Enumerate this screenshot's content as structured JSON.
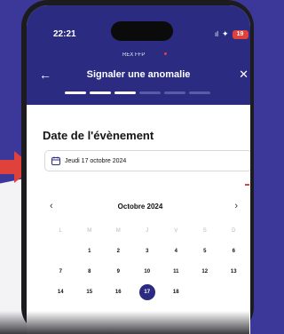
{
  "status_bar": {
    "time": "22:21",
    "signal": "ıl",
    "battery": "19"
  },
  "header": {
    "brand": "REX FFP",
    "title": "Signaler une anomalie",
    "back_icon": "arrow-left-icon",
    "close_icon": "close-icon"
  },
  "stepper": {
    "total": 6,
    "completed": 3
  },
  "section": {
    "title": "Date de l'évènement"
  },
  "date_field": {
    "value": "Jeudi 17 octobre 2024"
  },
  "calendar": {
    "month_label": "Octobre 2024",
    "weekdays": [
      "L",
      "M",
      "M",
      "J",
      "V",
      "S",
      "D"
    ],
    "weeks": [
      [
        "",
        "1",
        "2",
        "3",
        "4",
        "5",
        "6"
      ],
      [
        "7",
        "8",
        "9",
        "10",
        "11",
        "12",
        "13"
      ],
      [
        "14",
        "15",
        "16",
        "17",
        "18",
        "",
        ""
      ]
    ],
    "selected_day": "17"
  },
  "colors": {
    "primary": "#2b2b82",
    "background": "#3b3899",
    "accent_red": "#e0413a"
  }
}
